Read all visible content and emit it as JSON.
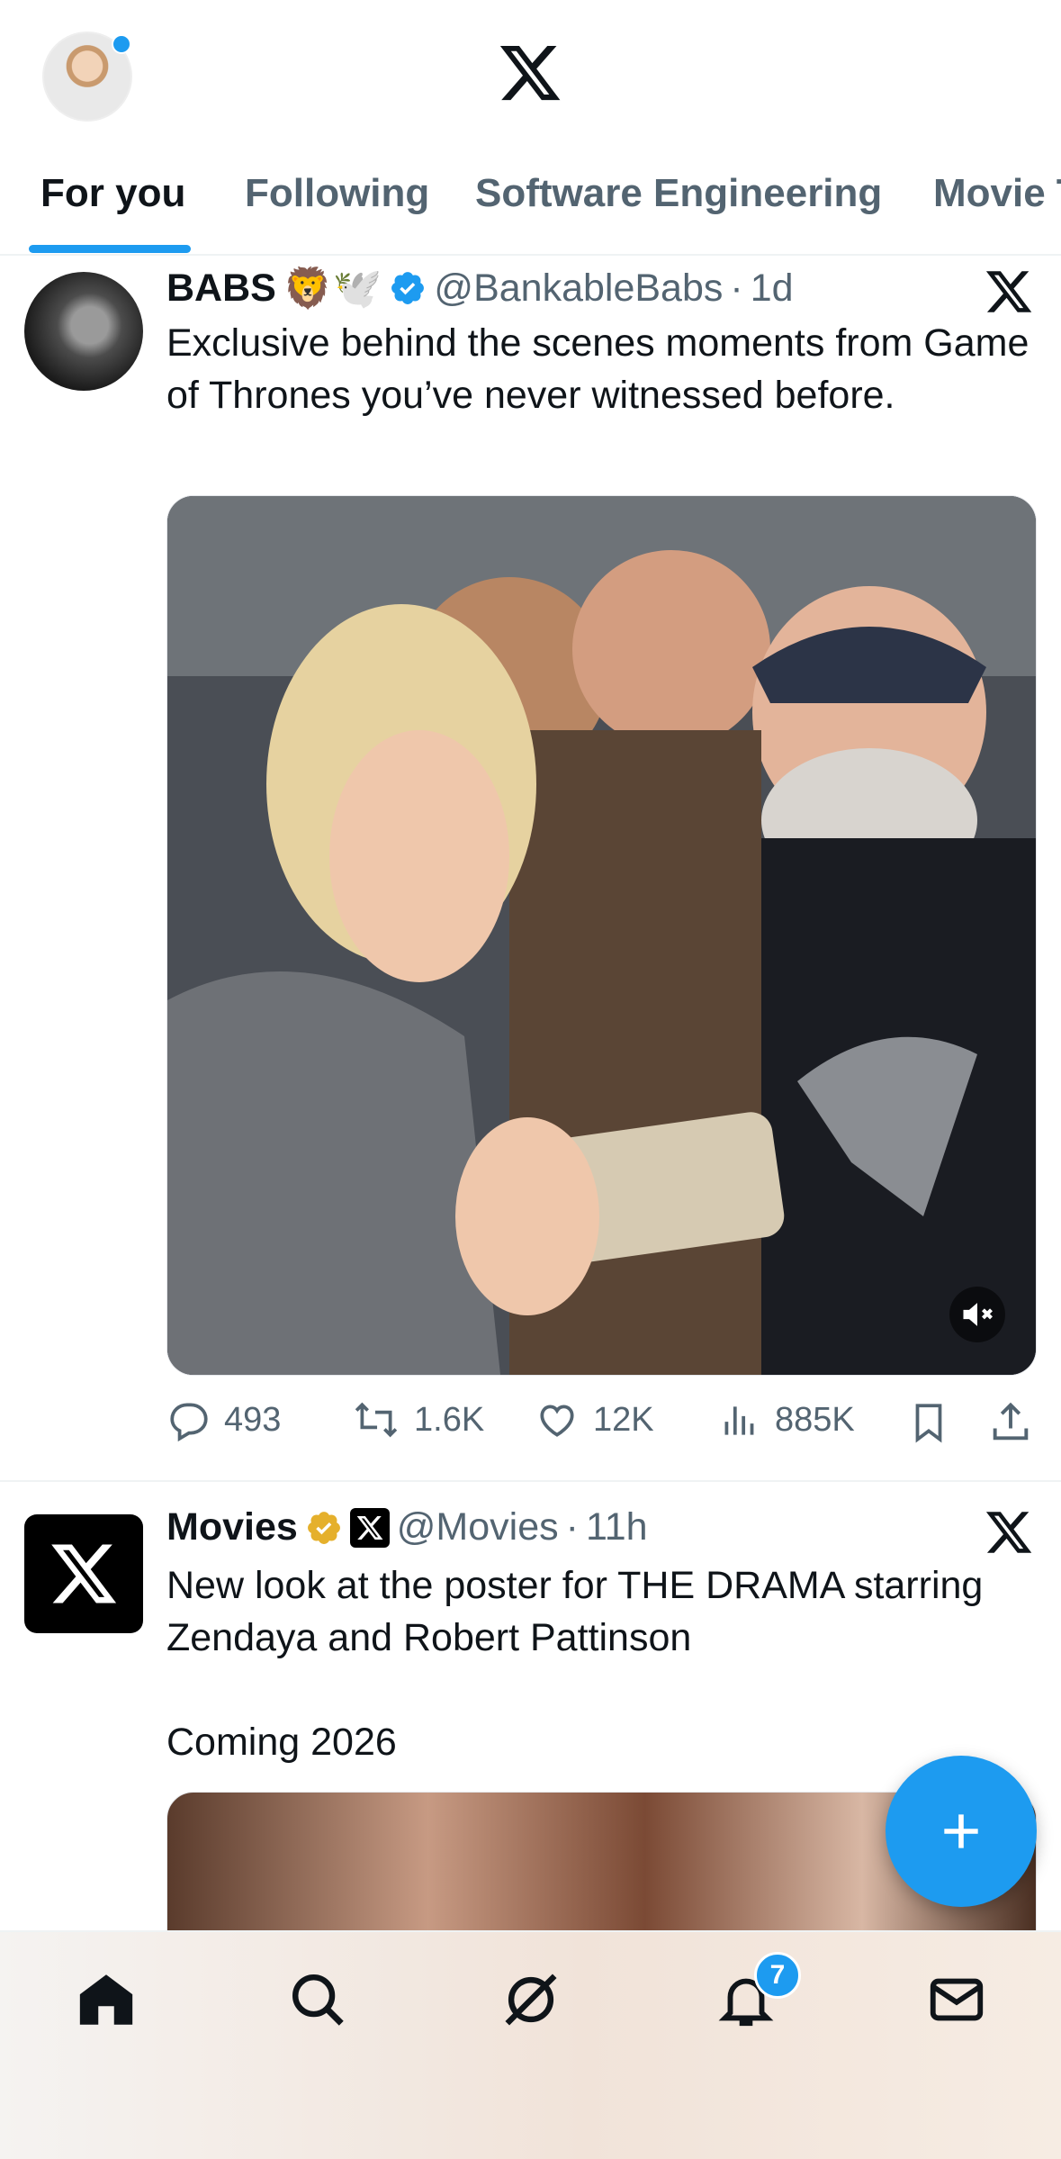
{
  "tabs": [
    {
      "label": "For you"
    },
    {
      "label": "Following"
    },
    {
      "label": "Software Engineering"
    },
    {
      "label": "Movie T"
    }
  ],
  "posts": [
    {
      "name": "BABS",
      "name_emojis": "🦁🕊️",
      "handle": "@BankableBabs",
      "dot": "·",
      "time": "1d",
      "text": "Exclusive behind the scenes moments from Game of Thrones you’ve never witnessed before.",
      "media_type": "video",
      "media_muted": true,
      "stats": {
        "replies": "493",
        "reposts": "1.6K",
        "likes": "12K",
        "views": "885K"
      }
    },
    {
      "name": "Movies",
      "handle": "@Movies",
      "dot": "·",
      "time": "11h",
      "text": "New look at the poster for THE DRAMA starring Zendaya and Robert Pattinson\n\nComing 2026",
      "media_type": "image"
    }
  ],
  "bottom_nav": {
    "notifications_badge": "7"
  },
  "colors": {
    "accent": "#1d9bf0",
    "text": "#0f1419",
    "muted": "#536471",
    "gold_badge": "#e5b02c"
  },
  "icons": [
    "x-logo",
    "close-icon",
    "reply-icon",
    "repost-icon",
    "like-icon",
    "views-icon",
    "bookmark-icon",
    "share-icon",
    "mute-icon",
    "plus-icon",
    "home-icon",
    "search-icon",
    "grok-icon",
    "bell-icon",
    "mail-icon"
  ]
}
